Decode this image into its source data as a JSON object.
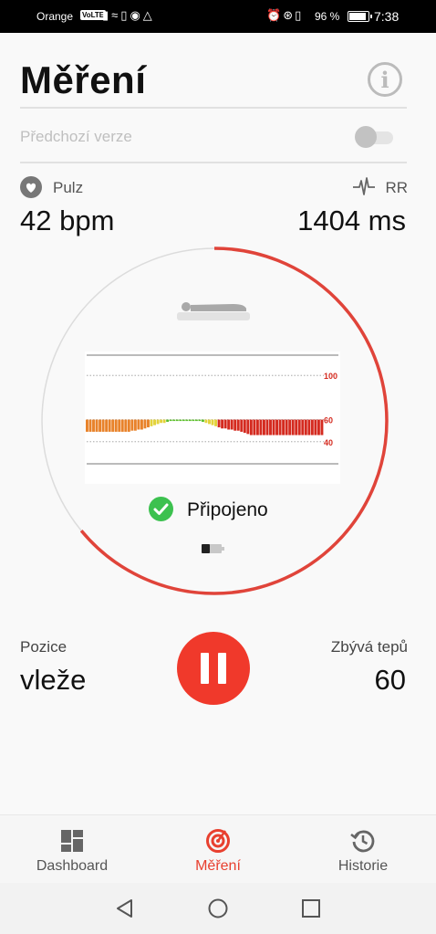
{
  "status_bar": {
    "carrier": "Orange",
    "volte_badge": "VoLTE",
    "battery_percent": "96 %",
    "battery_level": 0.96,
    "time": "7:38",
    "left_icons": [
      "signal-icon",
      "wifi-icon",
      "sim-icon",
      "pause-notification-icon",
      "app-notification-icon"
    ],
    "right_icons": [
      "alarm-icon",
      "bluetooth-icon",
      "vibrate-icon"
    ]
  },
  "header": {
    "title": "Měření",
    "info_icon": "info-icon"
  },
  "previous_version": {
    "label": "Předchozí verze",
    "enabled": false
  },
  "pulse": {
    "label": "Pulz",
    "value": "42 bpm",
    "icon": "heart-icon"
  },
  "rr": {
    "label": "RR",
    "value": "1404 ms",
    "icon": "ecg-wave-icon"
  },
  "progress": {
    "fraction": 0.64,
    "color": "#e0443a",
    "track_color": "#dcdcdc"
  },
  "position_icon": "lying-person-icon",
  "chart_data": {
    "type": "bar",
    "ylim": [
      20,
      120
    ],
    "reference_lines": [
      100,
      60,
      40
    ],
    "tick_labels": [
      "100",
      "60",
      "40"
    ],
    "baseline": 60,
    "values": [
      49,
      49,
      49,
      49,
      49,
      49,
      49,
      49,
      49,
      49,
      49,
      49,
      49,
      49,
      50,
      50,
      51,
      51,
      52,
      53,
      54,
      55,
      56,
      57,
      57,
      58,
      59,
      59,
      59,
      59,
      59,
      59,
      59,
      59,
      59,
      59,
      58,
      57,
      56,
      55,
      54,
      53,
      52,
      52,
      51,
      51,
      50,
      50,
      49,
      48,
      47,
      46,
      46,
      46,
      46,
      46,
      46,
      46,
      46,
      46,
      46,
      46,
      46,
      46,
      46,
      46,
      46,
      46,
      46,
      46,
      46,
      46,
      46,
      46
    ],
    "colors": {
      "red": "#d42a1f",
      "orange": "#e8822a",
      "yellow": "#e3d23a",
      "green": "#5cbf2a"
    }
  },
  "connection": {
    "status": "Připojeno",
    "icon": "check-circle-icon",
    "device_battery_icon": "device-battery-icon"
  },
  "position": {
    "label": "Pozice",
    "value": "vleže"
  },
  "pause_button": {
    "icon": "pause-icon",
    "color": "#f0392b"
  },
  "remaining_beats": {
    "label": "Zbývá tepů",
    "value": "60"
  },
  "bottom_nav": {
    "items": [
      {
        "label": "Dashboard",
        "icon": "dashboard-icon",
        "active": false
      },
      {
        "label": "Měření",
        "icon": "measure-target-icon",
        "active": true
      },
      {
        "label": "Historie",
        "icon": "history-icon",
        "active": false
      }
    ]
  },
  "system_nav": {
    "buttons": [
      "back-icon",
      "home-icon",
      "recents-icon"
    ]
  }
}
